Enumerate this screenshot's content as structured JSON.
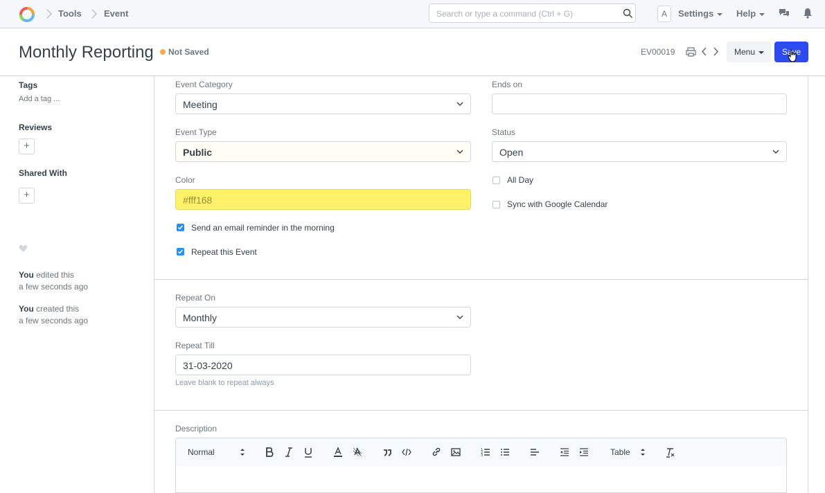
{
  "navbar": {
    "breadcrumbs": [
      "Tools",
      "Event"
    ],
    "search_placeholder": "Search or type a command (Ctrl + G)",
    "avatar_letter": "A",
    "settings_label": "Settings",
    "help_label": "Help"
  },
  "page": {
    "title": "Monthly Reporting",
    "status": "Not Saved",
    "status_color": "#f0ad4e",
    "doc_name": "EV00019",
    "menu_label": "Menu",
    "save_label": "Save"
  },
  "sidebar": {
    "tags_label": "Tags",
    "add_tag": "Add a tag ...",
    "reviews_label": "Reviews",
    "shared_label": "Shared With",
    "activity": [
      {
        "user": "You",
        "action": " edited this",
        "time": "a few seconds ago"
      },
      {
        "user": "You",
        "action": " created this",
        "time": "a few seconds ago"
      }
    ]
  },
  "form": {
    "event_category": {
      "label": "Event Category",
      "value": "Meeting"
    },
    "ends_on": {
      "label": "Ends on",
      "value": ""
    },
    "event_type": {
      "label": "Event Type",
      "value": "Public"
    },
    "status": {
      "label": "Status",
      "value": "Open"
    },
    "color": {
      "label": "Color",
      "value": "#fff168"
    },
    "all_day": {
      "label": "All Day",
      "checked": false
    },
    "sync_google": {
      "label": "Sync with Google Calendar",
      "checked": false
    },
    "email_reminder": {
      "label": "Send an email reminder in the morning",
      "checked": true
    },
    "repeat_event": {
      "label": "Repeat this Event",
      "checked": true
    },
    "repeat_on": {
      "label": "Repeat On",
      "value": "Monthly"
    },
    "repeat_till": {
      "label": "Repeat Till",
      "value": "31-03-2020",
      "help": "Leave blank to repeat always"
    },
    "description": {
      "label": "Description"
    }
  },
  "editor": {
    "style_select": "Normal",
    "table_select": "Table"
  },
  "colors": {
    "primary": "#2c4aef",
    "color_field_bg": "#fff168",
    "checkbox": "#2490ef"
  }
}
